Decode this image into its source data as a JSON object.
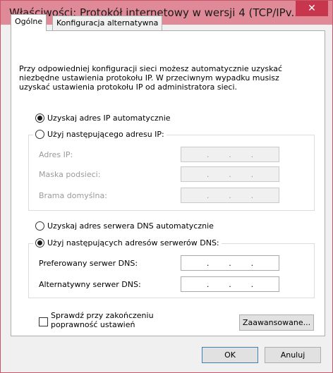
{
  "window": {
    "title": "Właściwości: Protokół internetowy w wersji 4 (TCP/IPv...",
    "close_glyph": "✕"
  },
  "tabs": [
    {
      "label": "Ogólne"
    },
    {
      "label": "Konfiguracja alternatywna"
    }
  ],
  "general": {
    "description": "Przy odpowiedniej konfiguracji sieci możesz automatycznie uzyskać niezbędne ustawienia protokołu IP. W przeciwnym wypadku musisz uzyskać ustawienia protokołu IP od administratora sieci.",
    "ip_auto_label": "Uzyskaj adres IP automatycznie",
    "ip_manual_label": "Użyj następującego adresu IP:",
    "ip_address_label": "Adres IP:",
    "subnet_mask_label": "Maska podsieci:",
    "gateway_label": "Brama domyślna:",
    "dns_auto_label": "Uzyskaj adres serwera DNS automatycznie",
    "dns_manual_label": "Użyj następujących adresów serwerów DNS:",
    "preferred_dns_label": "Preferowany serwer DNS:",
    "alternate_dns_label": "Alternatywny serwer DNS:",
    "ip_dot": ".",
    "validate_label": "Sprawdź przy zakończeniu poprawność ustawień",
    "advanced_button": "Zaawansowane..."
  },
  "footer": {
    "ok_button": "OK",
    "cancel_button": "Anuluj"
  },
  "colors": {
    "titlebar": "#e08a98",
    "close_button": "#c7364c"
  }
}
